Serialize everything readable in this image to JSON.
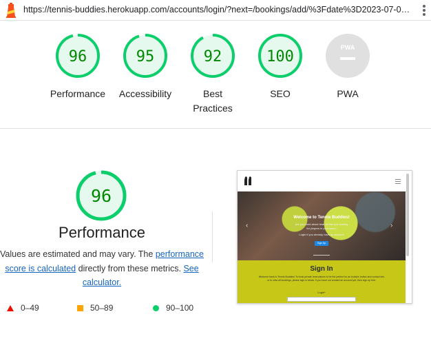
{
  "address_bar": {
    "url": "https://tennis-buddies.herokuapp.com/accounts/login/?next=/bookings/add/%3Fdate%3D2023-07-05%2..."
  },
  "categories": [
    {
      "id": "performance",
      "label": "Performance",
      "score": "96",
      "value": 96,
      "status": "pass"
    },
    {
      "id": "accessibility",
      "label": "Accessibility",
      "score": "95",
      "value": 95,
      "status": "pass"
    },
    {
      "id": "best-practices",
      "label_line1": "Best",
      "label_line2": "Practices",
      "score": "92",
      "value": 92,
      "status": "pass"
    },
    {
      "id": "seo",
      "label": "SEO",
      "score": "100",
      "value": 100,
      "status": "pass"
    },
    {
      "id": "pwa",
      "label": "PWA",
      "badge": "PWA",
      "status": "na"
    }
  ],
  "performance_detail": {
    "score": "96",
    "value": 96,
    "title": "Performance",
    "desc_part1": "Values are estimated and may vary. The ",
    "desc_link1": "performance score is calculated",
    "desc_part2": " directly from these metrics. ",
    "desc_link2": "See calculator."
  },
  "legend": [
    {
      "shape": "triangle",
      "range": "0–49",
      "color": "#eb0f00"
    },
    {
      "shape": "square",
      "range": "50–89",
      "color": "#ffa400"
    },
    {
      "shape": "circle",
      "range": "90–100",
      "color": "#0cce6b"
    }
  ],
  "thumbnail": {
    "hero_title": "Welcome to Tennis Buddies!",
    "hero_line1": "Are you tired about time off fine just looking",
    "hero_line2": "for players in your area?",
    "hero_line3": "Login   if you already have an account",
    "hero_button": "Sign Up",
    "signin_title": "Sign In",
    "signin_text": "Welcome back to Tennis Buddies! To book private reservations to be the perfect for an buddy's button and contact info or to view all bookings, please sign in below. If you have not created an account yet, then sign up first.",
    "signin_login": "Login*"
  },
  "colors": {
    "pass_ring": "#0cce6b",
    "pass_fill": "#e5f9ef",
    "pass_text": "#008800",
    "na_fill": "#e0e0e0",
    "link": "#1565c0"
  }
}
